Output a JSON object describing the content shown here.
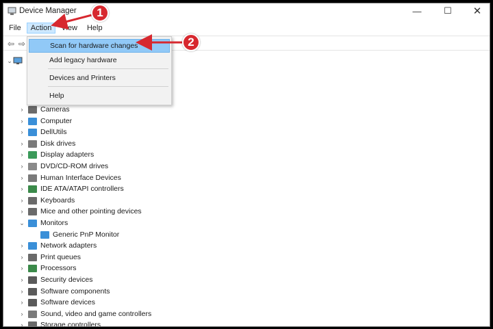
{
  "window": {
    "title": "Device Manager"
  },
  "controls": {
    "minimize": "—",
    "maximize": "☐",
    "close": "✕"
  },
  "menubar": [
    "File",
    "Action",
    "View",
    "Help"
  ],
  "action_menu": {
    "items": [
      "Scan for hardware changes",
      "Add legacy hardware",
      "Devices and Printers",
      "Help"
    ],
    "highlighted": "Scan for hardware changes"
  },
  "tree": {
    "categories": [
      {
        "label": "Cameras",
        "color": "#6b6b6b"
      },
      {
        "label": "Computer",
        "color": "#3a8fd8"
      },
      {
        "label": "DellUtils",
        "color": "#3a8fd8"
      },
      {
        "label": "Disk drives",
        "color": "#7a7a7a"
      },
      {
        "label": "Display adapters",
        "color": "#3b9a5a"
      },
      {
        "label": "DVD/CD-ROM drives",
        "color": "#8a8a8a"
      },
      {
        "label": "Human Interface Devices",
        "color": "#7a7a7a"
      },
      {
        "label": "IDE ATA/ATAPI controllers",
        "color": "#3b8a4a"
      },
      {
        "label": "Keyboards",
        "color": "#6a6a6a"
      },
      {
        "label": "Mice and other pointing devices",
        "color": "#6a6a6a"
      },
      {
        "label": "Monitors",
        "color": "#3a8fd8",
        "expanded": true
      },
      {
        "label": "Network adapters",
        "color": "#3a8fd8"
      },
      {
        "label": "Print queues",
        "color": "#6a6a6a"
      },
      {
        "label": "Processors",
        "color": "#3b8a4a"
      },
      {
        "label": "Security devices",
        "color": "#5a5a5a"
      },
      {
        "label": "Software components",
        "color": "#5a5a5a"
      },
      {
        "label": "Software devices",
        "color": "#5a5a5a"
      },
      {
        "label": "Sound, video and game controllers",
        "color": "#7a7a7a"
      },
      {
        "label": "Storage controllers",
        "color": "#6a6a6a"
      }
    ],
    "monitor_child": "Generic PnP Monitor"
  },
  "annotations": {
    "badge1": "1",
    "badge2": "2"
  },
  "colors": {
    "accent": "#d7282f",
    "highlight": "#91c9f7"
  }
}
